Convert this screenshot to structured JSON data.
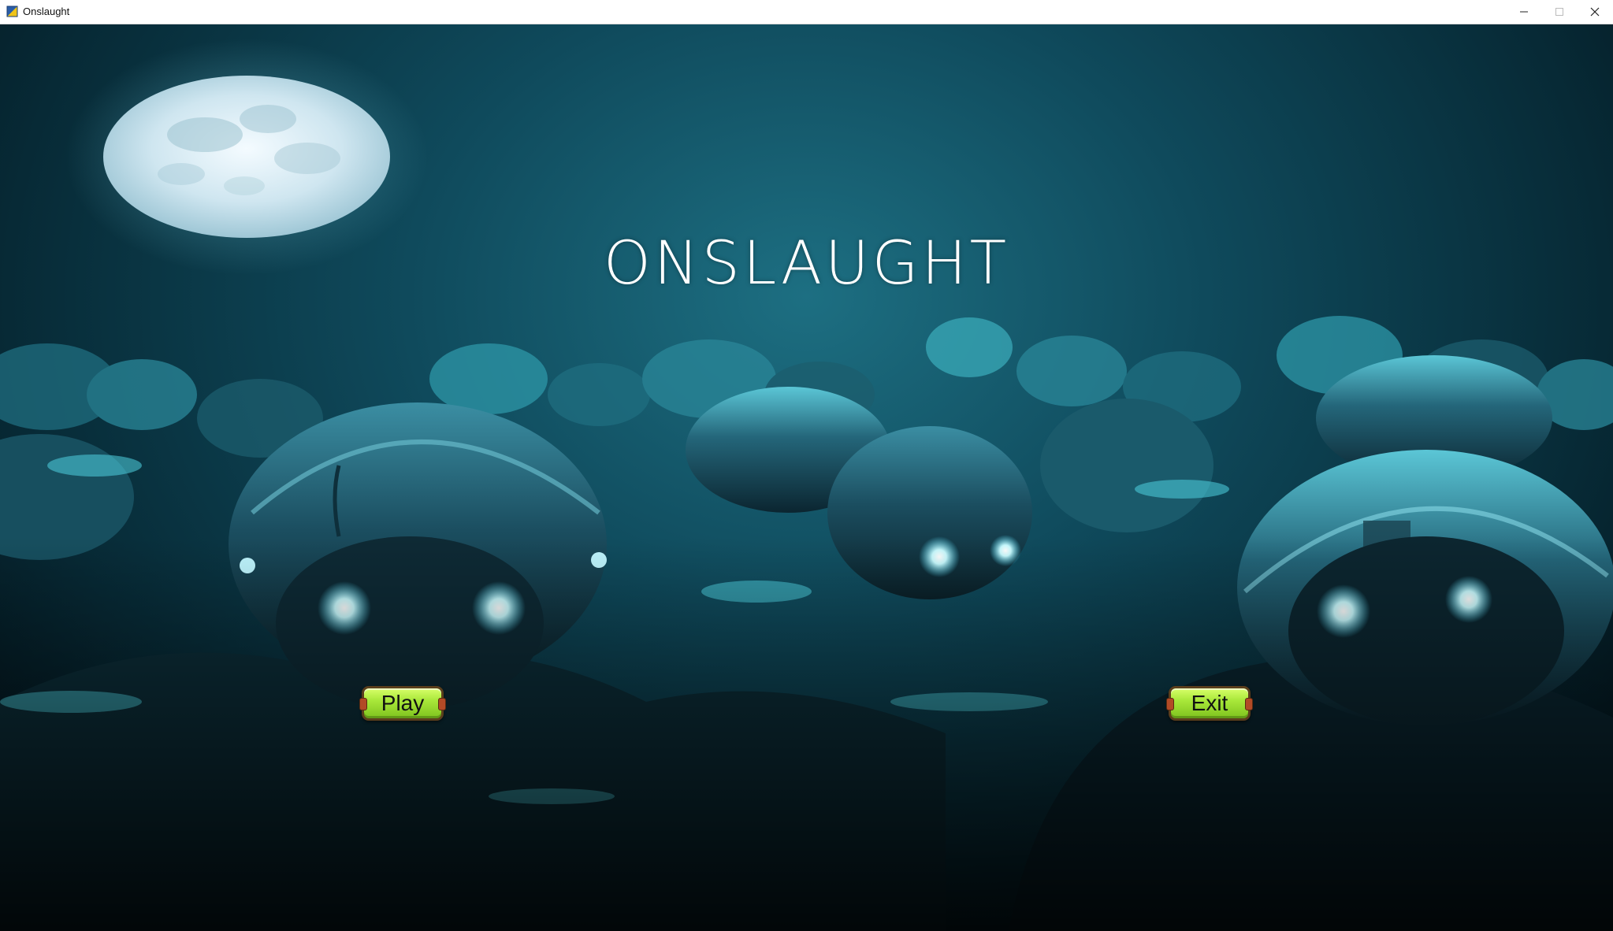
{
  "window": {
    "title": "Onslaught",
    "controls": [
      "minimize-icon",
      "maximize-icon",
      "close-icon"
    ]
  },
  "scene": {
    "game_title": "ONSLAUGHT",
    "background": "night sky with full moon and crowd of glowing-eyed helmeted figures"
  },
  "menu": {
    "play_label": "Play",
    "exit_label": "Exit"
  },
  "colors": {
    "button_fill": "#a9e83a",
    "button_border": "#5b3e1c",
    "title_text": "#ffffff",
    "scene_tint": "#0f4a5c"
  }
}
